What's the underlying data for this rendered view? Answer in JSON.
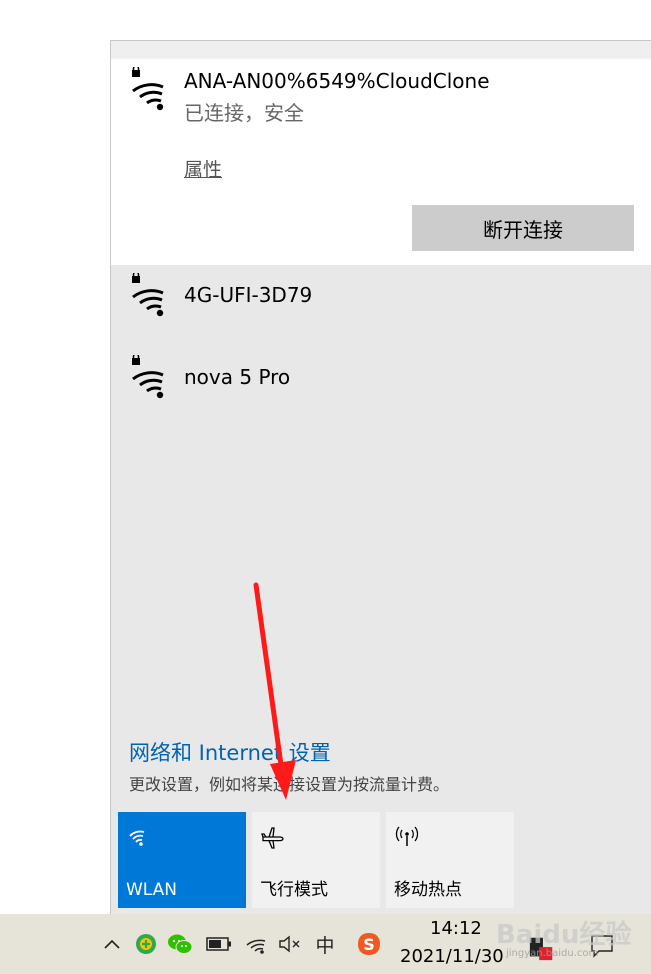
{
  "connected_network": {
    "ssid": "ANA-AN00%6549%CloudClone",
    "status": "已连接，安全",
    "properties_label": "属性",
    "disconnect_label": "断开连接"
  },
  "networks": [
    {
      "ssid": "4G-UFI-3D79"
    },
    {
      "ssid": "nova 5 Pro"
    }
  ],
  "settings": {
    "title": "网络和 Internet 设置",
    "description": "更改设置，例如将某连接设置为按流量计费。"
  },
  "quick_actions": [
    {
      "label": "WLAN",
      "icon": "wifi-icon",
      "active": true
    },
    {
      "label": "飞行模式",
      "icon": "airplane-icon",
      "active": false
    },
    {
      "label": "移动热点",
      "icon": "hotspot-icon",
      "active": false
    }
  ],
  "taskbar": {
    "time": "14:12",
    "date": "2021/11/30",
    "ime_label": "中",
    "sogou_label": "S"
  },
  "watermark": {
    "text": "Baidu经验",
    "sub": "jingyan.baidu.com"
  },
  "colors": {
    "accent": "#0078d7",
    "link": "#0063b1",
    "arrow": "#ff1a1a"
  }
}
